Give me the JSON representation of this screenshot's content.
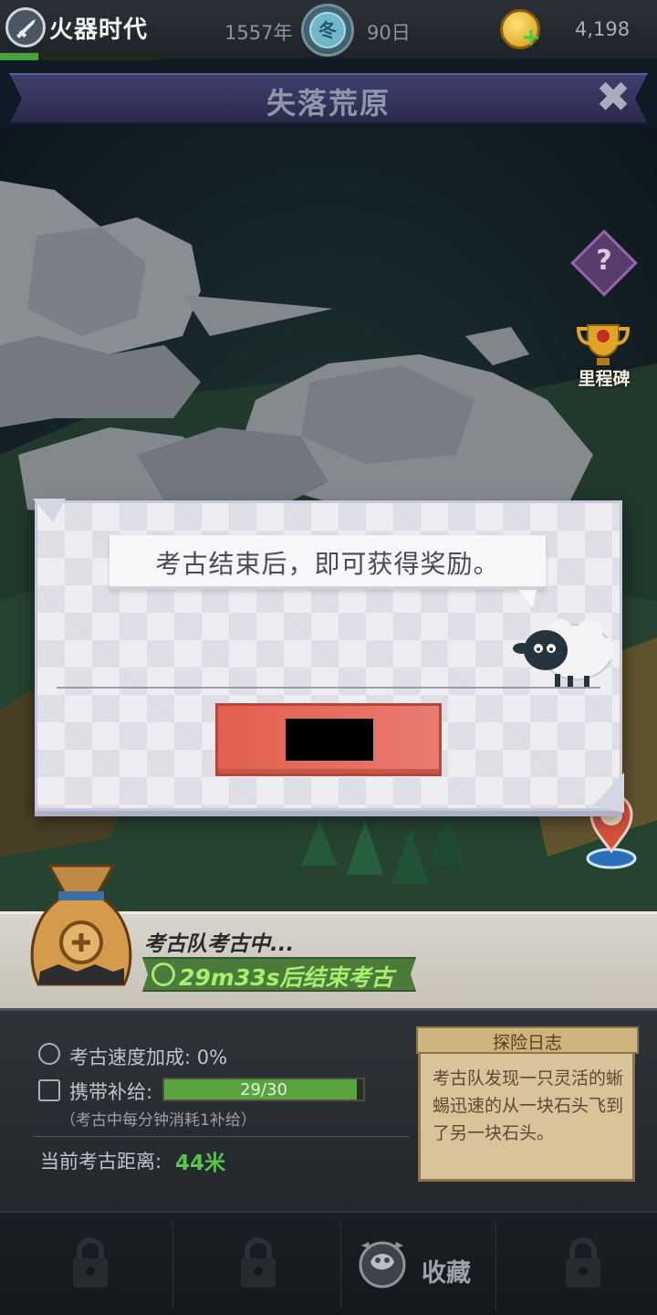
{
  "topbar": {
    "era_title": "火器时代",
    "year": "1557年",
    "season": "冬",
    "day": "90日",
    "coins": "4,198",
    "era_progress": 0.24
  },
  "banner": {
    "title": "失落荒原"
  },
  "map": {
    "milestone_label": "里程碑"
  },
  "dialog": {
    "message": "考古结束后，即可获得奖励。"
  },
  "expedition": {
    "status": "考古队考古中...",
    "timer": "29m33s后结束考古",
    "speed_label": "考古速度加成: 0%",
    "supply_label": "携带补给:",
    "supply_text": "29/30",
    "supply_fraction": 0.9667,
    "supply_note": "（考古中每分钟消耗1补给）",
    "distance_label": "当前考古距离:",
    "distance_value": "44米"
  },
  "log": {
    "title": "探险日志",
    "body": "考古队发现一只灵活的蜥蜴迅速的从一块石头飞到了另一块石头。"
  },
  "nav": {
    "collect_label": "收藏"
  },
  "colors": {
    "accent_green": "#58c64a",
    "button_red": "#e2604f",
    "banner_purple": "#3f3f6e"
  }
}
